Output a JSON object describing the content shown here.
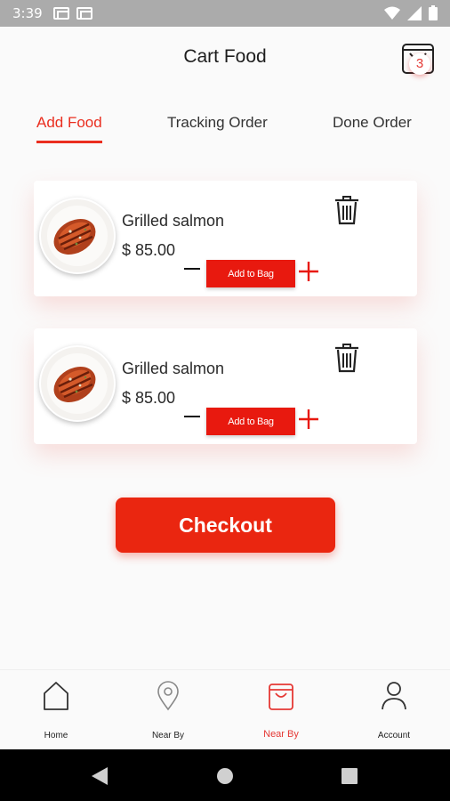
{
  "status_bar": {
    "time": "3:39"
  },
  "header": {
    "title": "Cart Food",
    "cart_count": "3"
  },
  "tabs": [
    {
      "label": "Add Food",
      "active": true
    },
    {
      "label": "Tracking Order",
      "active": false
    },
    {
      "label": "Done Order",
      "active": false
    }
  ],
  "cart_items": [
    {
      "name": "Grilled salmon",
      "price": "$ 85.00",
      "add_label": "Add to Bag"
    },
    {
      "name": "Grilled salmon",
      "price": "$ 85.00",
      "add_label": "Add to Bag"
    }
  ],
  "checkout_label": "Checkout",
  "bottom_nav": [
    {
      "label": "Home",
      "icon": "home-icon",
      "active": false
    },
    {
      "label": "Near By",
      "icon": "location-pin-icon",
      "active": false
    },
    {
      "label": "Near By",
      "icon": "shopping-bag-icon",
      "active": true
    },
    {
      "label": "Account",
      "icon": "person-icon",
      "active": false
    }
  ],
  "colors": {
    "accent": "#ea2610",
    "background": "#fafafa",
    "status_bar": "#ababab"
  }
}
